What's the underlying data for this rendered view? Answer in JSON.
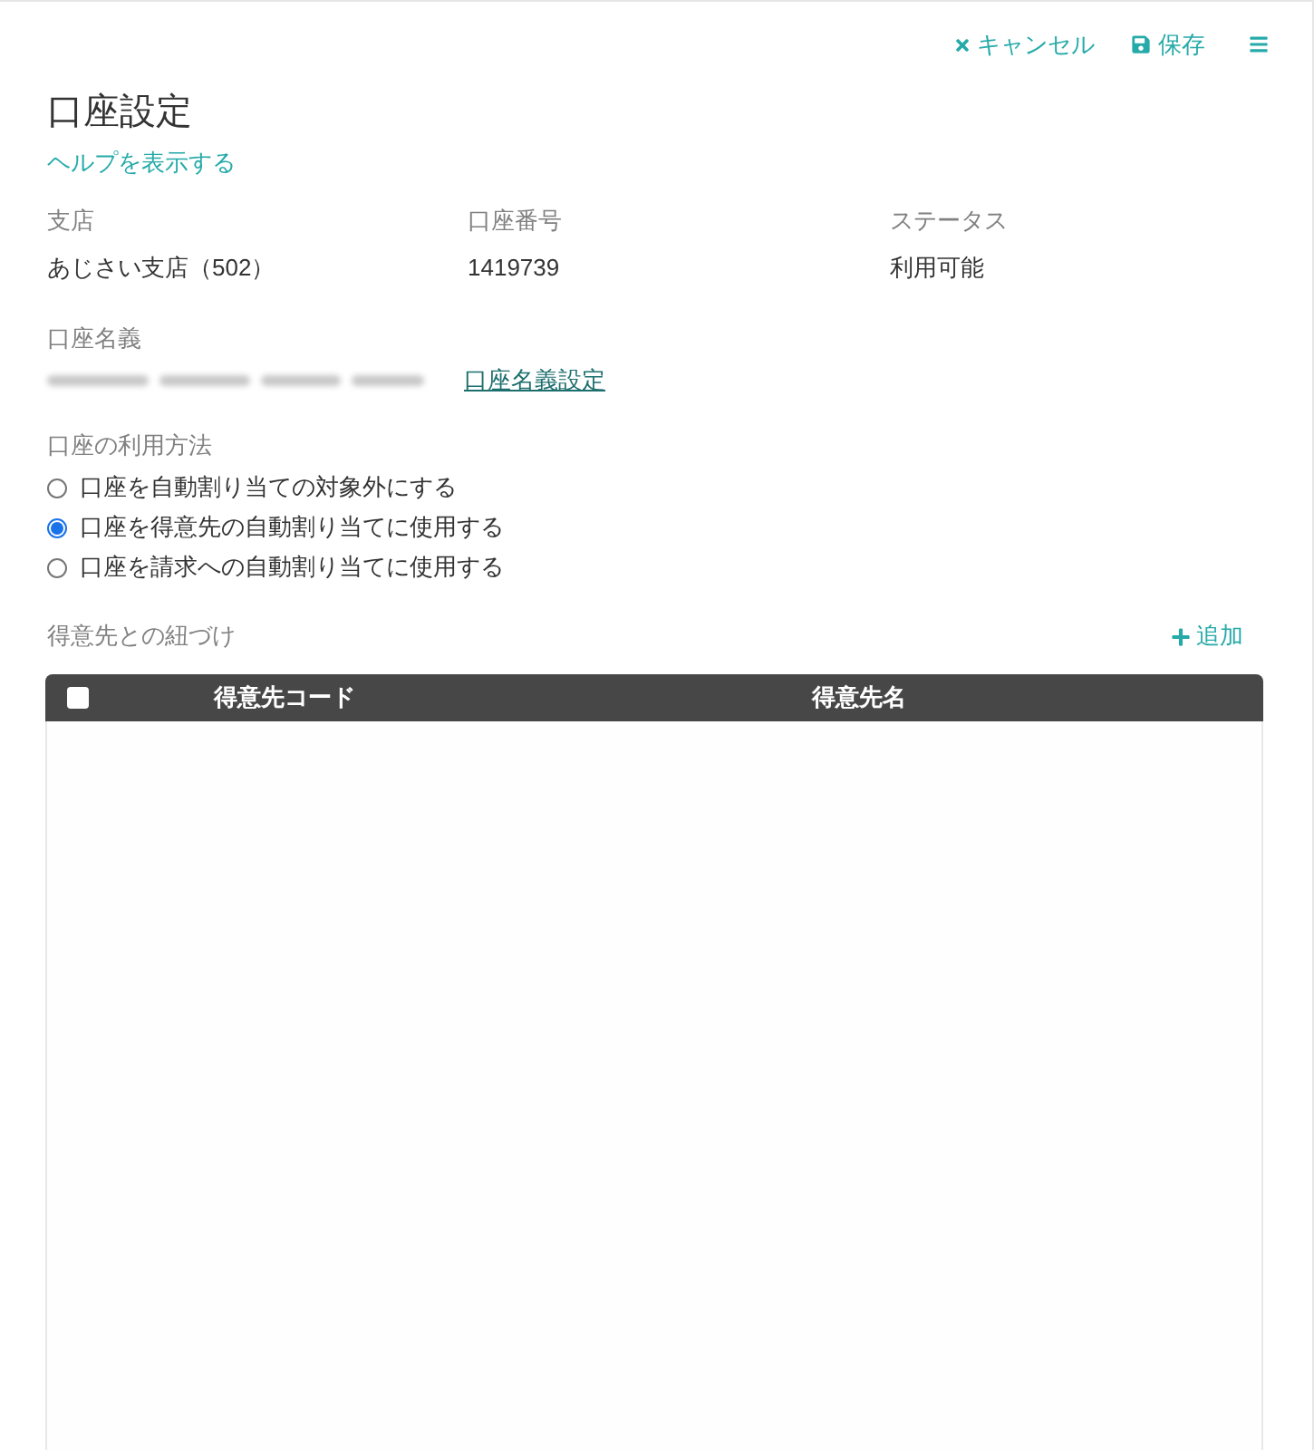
{
  "toolbar": {
    "buttons": [
      {
        "kind": "cancel",
        "label": "キャンセル"
      },
      {
        "kind": "save",
        "label": "保存"
      },
      {
        "kind": "menu"
      }
    ]
  },
  "title": "口座設定",
  "help_link": "ヘルプを表示する",
  "fields": [
    {
      "label": "支店",
      "value": "あじさい支店（502）"
    },
    {
      "label": "口座番号",
      "value": "1419739"
    },
    {
      "label": "ステータス",
      "value": "利用可能"
    }
  ],
  "account_holder": {
    "label": "口座名義",
    "link": "口座名義設定"
  },
  "usage": {
    "label": "口座の利用方法",
    "options": [
      {
        "label": "口座を自動割り当ての対象外にする",
        "selected": false
      },
      {
        "label": "口座を得意先の自動割り当てに使用する",
        "selected": true
      },
      {
        "label": "口座を請求への自動割り当てに使用する",
        "selected": false
      }
    ]
  },
  "customer_links": {
    "title": "得意先との紐づけ",
    "add_button": "追加",
    "table": {
      "select_all": {
        "checked": false
      },
      "columns": [
        "得意先コード",
        "得意先名"
      ]
    }
  }
}
